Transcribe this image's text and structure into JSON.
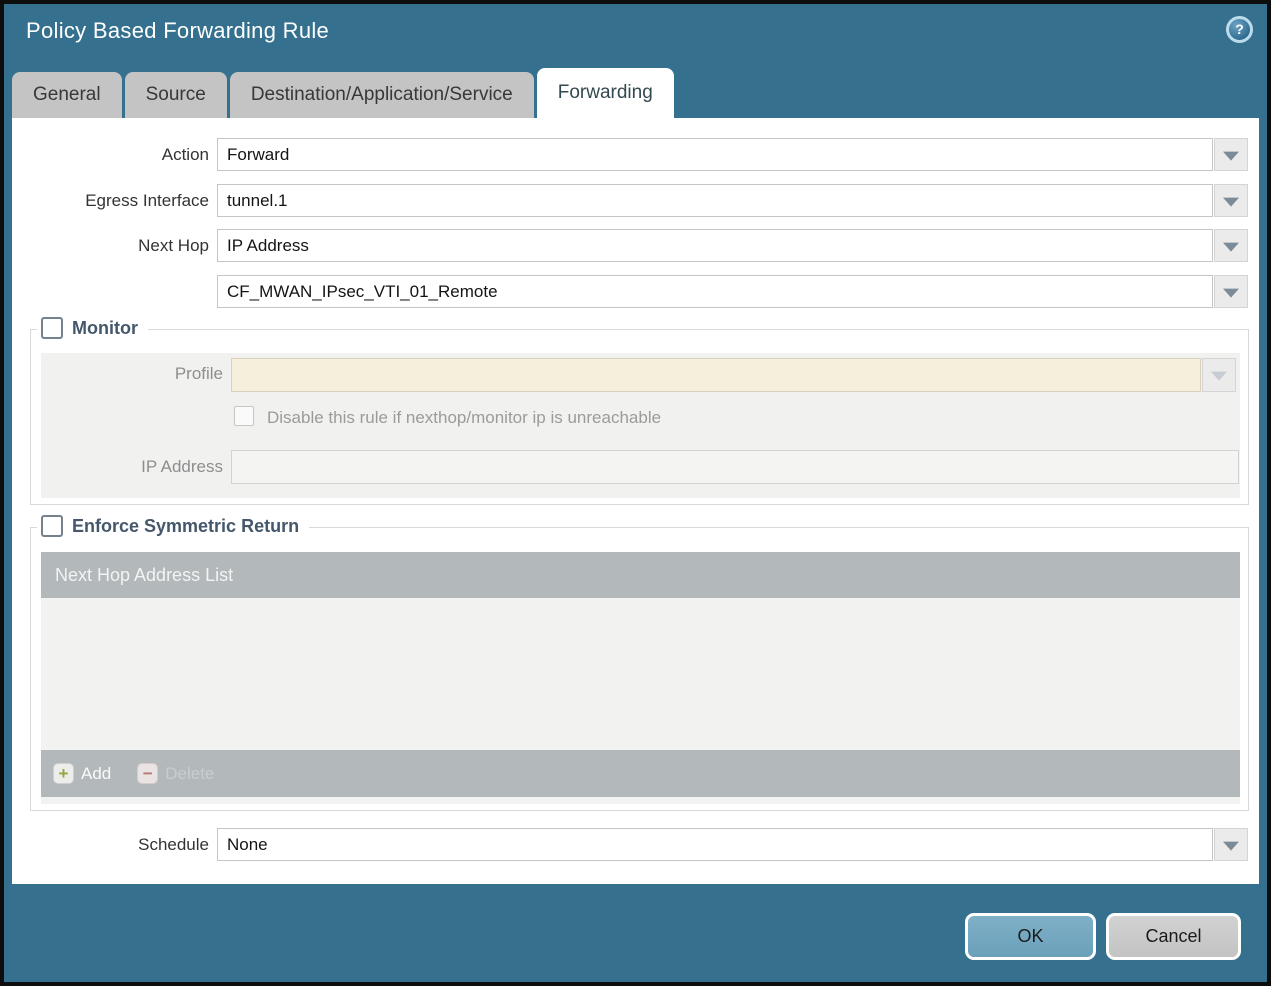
{
  "window": {
    "title": "Policy Based Forwarding Rule",
    "help_glyph": "?"
  },
  "tabs": [
    {
      "label": "General",
      "active": false
    },
    {
      "label": "Source",
      "active": false
    },
    {
      "label": "Destination/Application/Service",
      "active": false
    },
    {
      "label": "Forwarding",
      "active": true
    }
  ],
  "form": {
    "action": {
      "label": "Action",
      "value": "Forward"
    },
    "egress_interface": {
      "label": "Egress Interface",
      "value": "tunnel.1"
    },
    "next_hop": {
      "label": "Next Hop",
      "value": "IP Address"
    },
    "next_hop_address": {
      "value": "CF_MWAN_IPsec_VTI_01_Remote"
    },
    "schedule": {
      "label": "Schedule",
      "value": "None"
    }
  },
  "monitor": {
    "legend": "Monitor",
    "checked": false,
    "profile": {
      "label": "Profile",
      "value": ""
    },
    "disable_rule": {
      "label": "Disable this rule if nexthop/monitor ip is unreachable",
      "checked": false
    },
    "ip_address": {
      "label": "IP Address",
      "value": ""
    }
  },
  "symmetric_return": {
    "legend": "Enforce Symmetric Return",
    "checked": false,
    "table_header": "Next Hop Address List",
    "rows": [],
    "add_label": "Add",
    "add_icon": "+",
    "delete_label": "Delete",
    "delete_icon": "−"
  },
  "footer": {
    "ok_label": "OK",
    "cancel_label": "Cancel"
  },
  "colors": {
    "chrome_teal": "#35708f",
    "tab_inactive": "#c4c4c4",
    "required_field_beige": "#f5efdc",
    "table_chrome_gray": "#b3b8bb",
    "ok_button_blue": "#73a6bf",
    "legend_text": "#44576b"
  }
}
